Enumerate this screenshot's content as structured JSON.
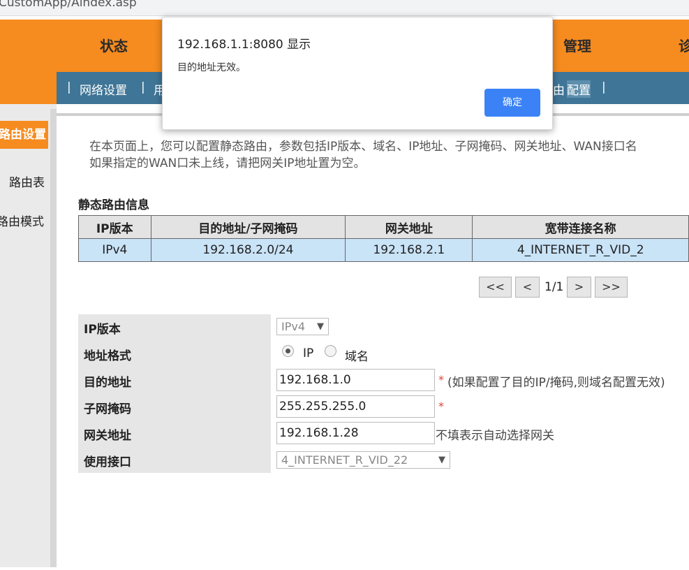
{
  "browser": {
    "url": "CustomApp/Aindex.asp"
  },
  "topnav": {
    "items": [
      "状态",
      "管理",
      "诊"
    ]
  },
  "subnav": {
    "items": [
      "|",
      "网络设置",
      "|",
      "用",
      "由",
      "配置",
      "|"
    ]
  },
  "sidebar": {
    "active": "路由设置",
    "items": [
      "路由表",
      "路由模式"
    ]
  },
  "intro": {
    "line1": "在本页面上，您可以配置静态路由，参数包括IP版本、域名、IP地址、子网掩码、网关地址、WAN接口名",
    "line2": "如果指定的WAN口未上线，请把网关IP地址置为空。"
  },
  "routes": {
    "title": "静态路由信息",
    "headers": [
      "IP版本",
      "目的地址/子网掩码",
      "网关地址",
      "宽带连接名称"
    ],
    "rows": [
      [
        "IPv4",
        "192.168.2.0/24",
        "192.168.2.1",
        "4_INTERNET_R_VID_2"
      ]
    ]
  },
  "pager": {
    "first": "<<",
    "prev": "<",
    "page": "1/1",
    "next": ">",
    "last": ">>"
  },
  "form": {
    "ip_version_label": "IP版本",
    "ip_version_value": "IPv4",
    "address_format_label": "地址格式",
    "address_format_options": [
      "IP",
      "域名"
    ],
    "address_format_selected": "IP",
    "dest_label": "目的地址",
    "dest_value": "192.168.1.0",
    "dest_hint": "(如果配置了目的IP/掩码,则域名配置无效)",
    "mask_label": "子网掩码",
    "mask_value": "255.255.255.0",
    "gateway_label": "网关地址",
    "gateway_value": "192.168.1.28",
    "gateway_hint": "不填表示自动选择网关",
    "interface_label": "使用接口",
    "interface_value": "4_INTERNET_R_VID_22",
    "required_mark": "*"
  },
  "dialog": {
    "title": "192.168.1.1:8080 显示",
    "message": "目的地址无效。",
    "ok_label": "确定",
    "ok_color": "#3b82f6"
  },
  "colors": {
    "brand_orange": "#f68b1f",
    "subnav_blue": "#3f7596",
    "selected_row": "#c9e3f7"
  }
}
